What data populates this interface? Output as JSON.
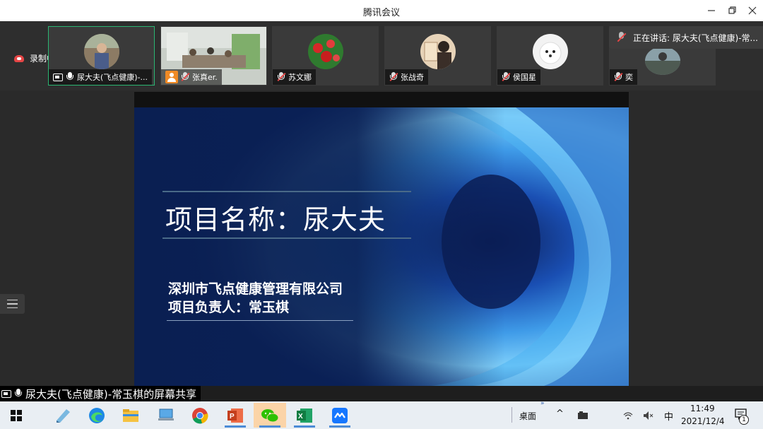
{
  "window": {
    "title": "腾讯会议"
  },
  "recording": {
    "label": "录制中"
  },
  "participants": [
    {
      "name": "尿大夫(飞点健康)-..."
    },
    {
      "name": "张真er."
    },
    {
      "name": "苏文娜"
    },
    {
      "name": "张战奇"
    },
    {
      "name": "侯国星"
    },
    {
      "name": "奕"
    }
  ],
  "speaking": {
    "label": "正在讲话: 尿大夫(飞点健康)-常..."
  },
  "slide": {
    "title": "项目名称：尿大夫",
    "company": "深圳市飞点健康管理有限公司",
    "owner": "项目负责人：常玉棋"
  },
  "share_banner": {
    "text": "尿大夫(飞点健康)-常玉棋的屏幕共享"
  },
  "taskbar": {
    "desktop_label": "桌面",
    "ime_label": "中",
    "time": "11:49",
    "date": "2021/12/4",
    "notification_count": "1"
  },
  "colors": {
    "active_border": "#2bb673",
    "record_red": "#e54545",
    "slide_bg": "#0a1f52",
    "taskbar_bg": "#e9eef3"
  }
}
